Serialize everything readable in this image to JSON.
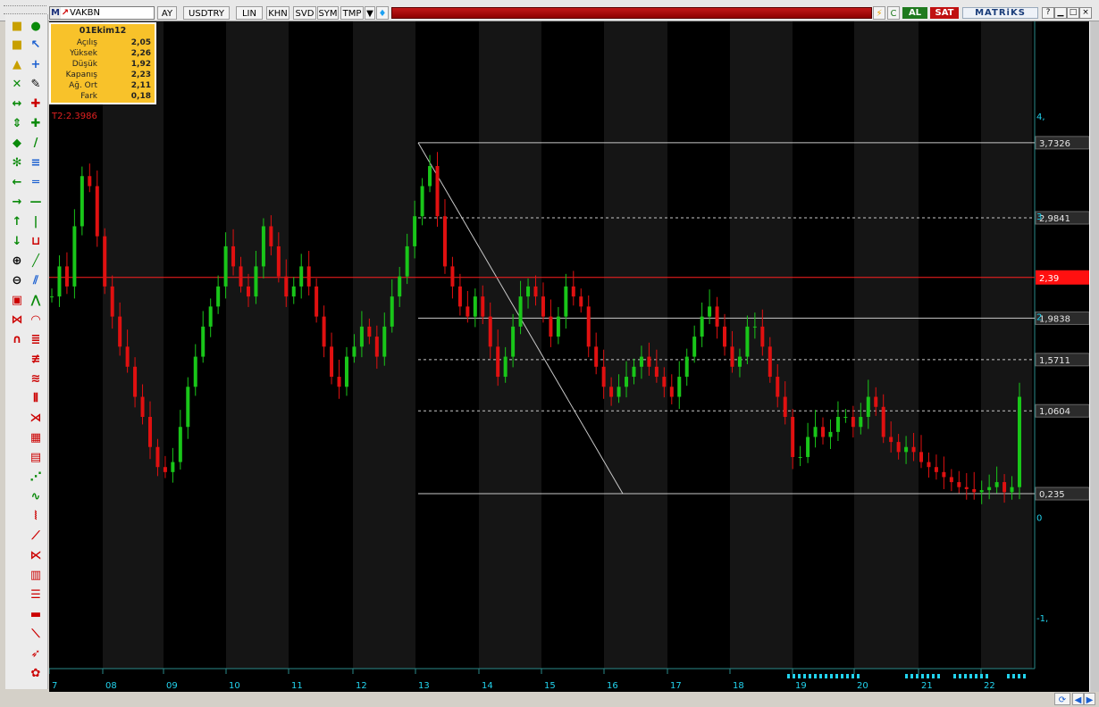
{
  "toolbar": {
    "symbol": "VAKBN",
    "buttons": [
      "AY",
      "USDTRY",
      "LIN",
      "KHN",
      "SVD",
      "SYM",
      "TMP"
    ],
    "buy_label": "AL",
    "sell_label": "SAT",
    "brand": "MATRiKS"
  },
  "infobox": {
    "date": "01Ekim12",
    "rows": [
      {
        "label": "Açılış",
        "value": "2,05"
      },
      {
        "label": "Yüksek",
        "value": "2,26"
      },
      {
        "label": "Düşük",
        "value": "1,92"
      },
      {
        "label": "Kapanış",
        "value": "2,23"
      },
      {
        "label": "Ağ. Ort",
        "value": "2,11"
      },
      {
        "label": "Fark",
        "value": "0,18"
      }
    ]
  },
  "t2_label": "T2:2.3986",
  "colors": {
    "background": "#000000",
    "band": "#151515",
    "up": "#19c619",
    "down": "#e01010",
    "price_line": "#ff2020",
    "axis_text": "#22d3ee",
    "fib_line": "#c8c8c8"
  },
  "chart_data": {
    "type": "candlestick",
    "x_ticks": [
      "7",
      "08",
      "09",
      "10",
      "11",
      "12",
      "13",
      "14",
      "15",
      "16",
      "17",
      "18",
      "19",
      "20",
      "21",
      "22"
    ],
    "y_ticks": [
      "4,",
      "3",
      "2",
      "0",
      "-1,"
    ],
    "current_price": "2,39",
    "fib_levels": [
      {
        "value": 3.7326,
        "label": "3,7326",
        "style": "solid"
      },
      {
        "value": 2.9841,
        "label": "2,9841",
        "style": "dashed"
      },
      {
        "value": 1.9838,
        "label": "1,9838",
        "style": "solid"
      },
      {
        "value": 1.5711,
        "label": "1,5711",
        "style": "dashed"
      },
      {
        "value": 1.0604,
        "label": "1,0604",
        "style": "dashed"
      },
      {
        "value": 0.235,
        "label": "0,235",
        "style": "solid"
      }
    ],
    "ylim": [
      -1.35,
      4.5
    ]
  }
}
